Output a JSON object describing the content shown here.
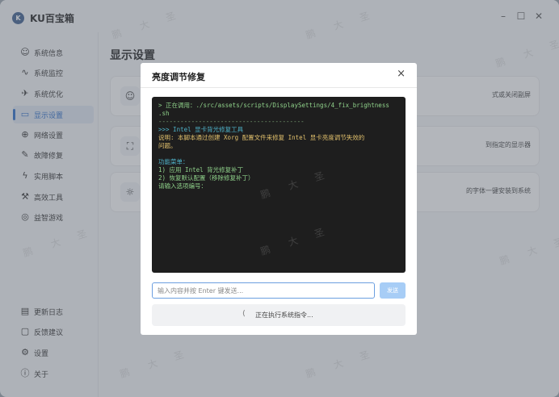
{
  "app": {
    "title": "KU百宝箱",
    "logo_text": "K"
  },
  "window_controls": {
    "minimize": "–",
    "maximize": "☐",
    "close": "✕"
  },
  "sidebar": {
    "items": [
      {
        "label": "系统信息",
        "icon": "☺"
      },
      {
        "label": "系统监控",
        "icon": "∿"
      },
      {
        "label": "系统优化",
        "icon": "✈"
      },
      {
        "label": "显示设置",
        "icon": "▭"
      },
      {
        "label": "网络设置",
        "icon": "⊕"
      },
      {
        "label": "故障修复",
        "icon": "✎"
      },
      {
        "label": "实用脚本",
        "icon": "ϟ"
      },
      {
        "label": "高效工具",
        "icon": "⚒"
      },
      {
        "label": "益智游戏",
        "icon": "◎"
      }
    ],
    "bottom_items": [
      {
        "label": "更新日志",
        "icon": "▤"
      },
      {
        "label": "反馈建议",
        "icon": "▢"
      },
      {
        "label": "设置",
        "icon": "⚙"
      },
      {
        "label": "关于",
        "icon": "ⓘ"
      }
    ]
  },
  "main": {
    "title": "显示设置",
    "cards": [
      {
        "icon": "☺",
        "desc": "式或关闭副屏"
      },
      {
        "icon": "⛶",
        "desc": "到指定的显示器"
      },
      {
        "icon": "☼",
        "desc": "的字体一键安装到系统"
      }
    ]
  },
  "dialog": {
    "title": "亮度调节修复",
    "close": "×",
    "terminal_lines": [
      {
        "text": "> 正在调用：./src/assets/scripts/DisplaySettings/4_fix_brightness",
        "color": "green"
      },
      {
        "text": ".sh",
        "color": "green"
      },
      {
        "text": "----------------------------------------",
        "color": "dim"
      },
      {
        "text": ">>> Intel 显卡背光修复工具",
        "color": "cyan"
      },
      {
        "text": "说明: 本脚本通过创建 Xorg 配置文件来修复 Intel 显卡亮度调节失效的",
        "color": "yellow"
      },
      {
        "text": "问题。",
        "color": "yellow"
      },
      {
        "text": "",
        "color": "green"
      },
      {
        "text": "功能菜单：",
        "color": "cyan"
      },
      {
        "text": "1) 应用 Intel 背光修复补丁",
        "color": "green"
      },
      {
        "text": "2) 恢复默认配置（移除修复补丁）",
        "color": "green"
      },
      {
        "text": "请输入选项编号：",
        "color": "green"
      }
    ],
    "input_placeholder": "输入内容并按 Enter 键发送...",
    "send_label": "发送",
    "status_text": "正在执行系统指令...",
    "spinner": "⟨"
  },
  "watermark": {
    "chars": [
      "鹏",
      "大",
      "圣"
    ]
  },
  "colors": {
    "accent": "#2d6ec9",
    "terminal_bg": "#1e1e1e",
    "send_button": "#a7cdf6"
  }
}
